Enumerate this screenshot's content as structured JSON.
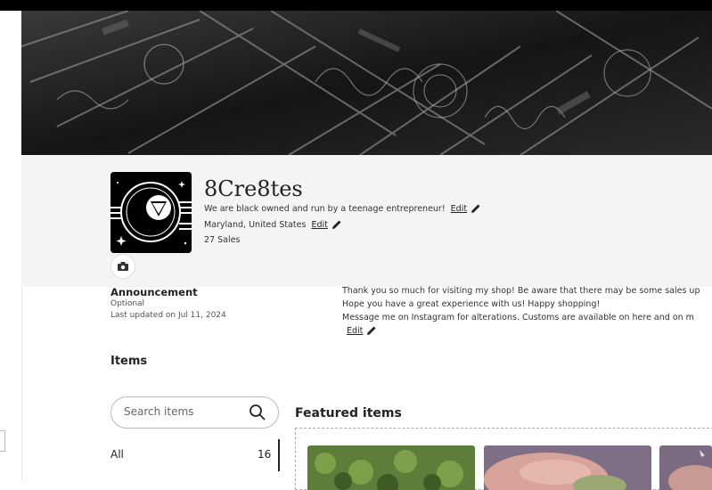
{
  "shop": {
    "name": "8Cre8tes",
    "tagline": "We are black owned and run by a teenage entrepreneur!",
    "location": "Maryland, United States",
    "sales": "27 Sales",
    "edit_label": "Edit"
  },
  "announcement": {
    "title": "Announcement",
    "optional": "Optional",
    "updated": "Last updated on Jul 11, 2024",
    "lines": [
      "Thank you so much for visiting my shop! Be aware that there may be some sales up",
      "Hope you have a great experience with us! Happy shopping!",
      "Message me on Instagram for alterations. Customs are available on here and on m"
    ],
    "edit_label": "Edit"
  },
  "items": {
    "heading": "Items",
    "search_placeholder": "Search items",
    "categories": [
      {
        "label": "All",
        "count": "16"
      }
    ]
  },
  "featured": {
    "heading": "Featured items"
  },
  "colors": {
    "panel_bg": "#f4f4f4",
    "text": "#222222"
  },
  "icons": [
    "camera-icon",
    "pencil-icon",
    "search-icon"
  ]
}
